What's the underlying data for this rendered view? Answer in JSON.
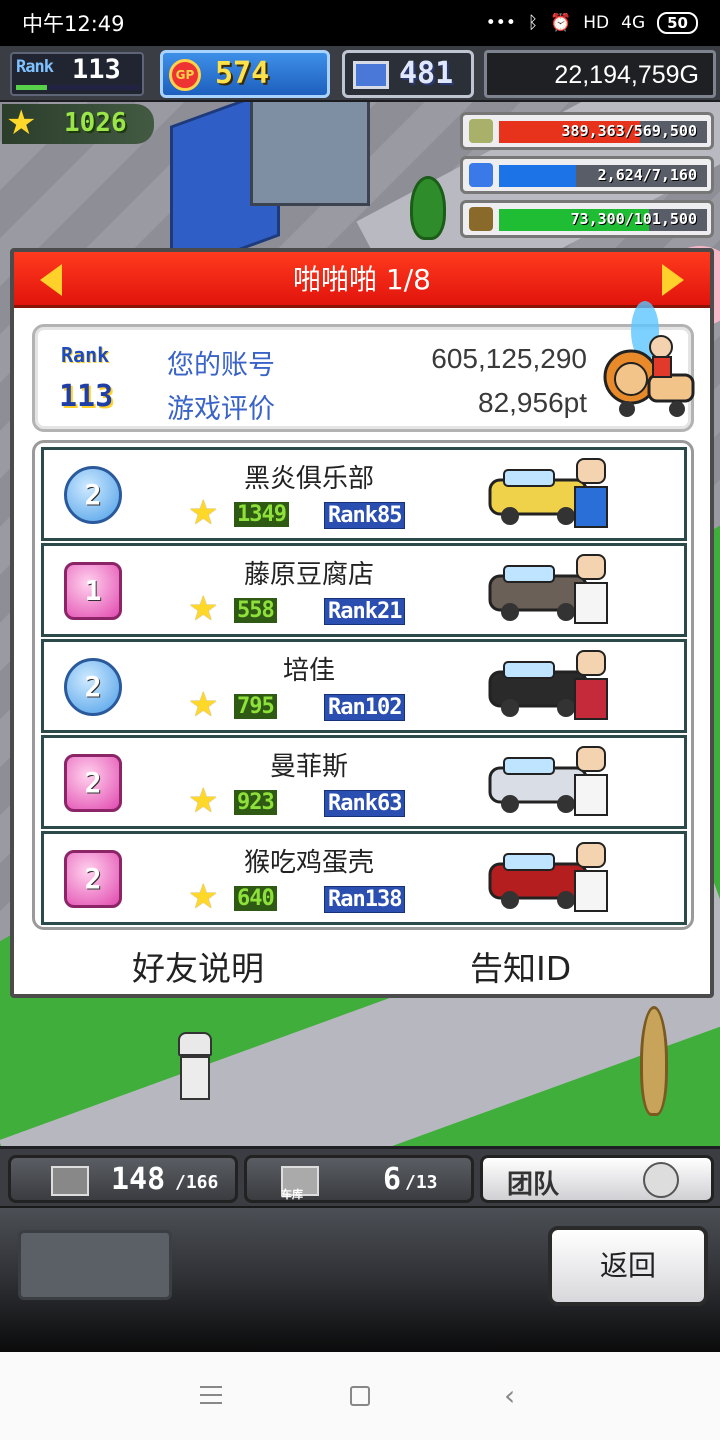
{
  "status_bar": {
    "time": "中午12:49",
    "signal_text": "4G",
    "hd_text": "HD",
    "battery": "50"
  },
  "hud": {
    "rank_label": "Rank",
    "rank_value": "113",
    "rank_progress": 0.25,
    "gp_icon": "GP",
    "gp_value": "574",
    "pc_value": "481",
    "money": "22,194,759G",
    "stars": "1026"
  },
  "resources": [
    {
      "icon": "coins-icon",
      "text": "389,363/569,500",
      "fraction": 0.68,
      "color": "#e8331c"
    },
    {
      "icon": "bottle-icon",
      "text": "2,624/7,160",
      "fraction": 0.37,
      "color": "#1c73e8"
    },
    {
      "icon": "leaf-icon",
      "text": "73,300/101,500",
      "fraction": 0.72,
      "color": "#1ebd34"
    }
  ],
  "dialog": {
    "title": "啪啪啪 1/8",
    "account": {
      "rank_label": "Rank",
      "rank_value": "113",
      "label_account": "您的账号",
      "label_rating": "游戏评价",
      "value_account": "605,125,290",
      "value_rating": "82,956pt"
    },
    "friends": [
      {
        "badge": "2",
        "badge_style": "blue",
        "name": "黑炎俱乐部",
        "stars": "1349",
        "rank": "Rank85",
        "vehicle_color": "#f0d24a",
        "driver_color": "#2a6fd8"
      },
      {
        "badge": "1",
        "badge_style": "pink",
        "name": "藤原豆腐店",
        "stars": "558",
        "rank": "Rank21",
        "vehicle_color": "#6a6057",
        "driver_color": "#f5f5f5"
      },
      {
        "badge": "2",
        "badge_style": "blue",
        "name": "培佳",
        "stars": "795",
        "rank": "Ran102",
        "vehicle_color": "#2a2a2a",
        "driver_color": "#c42a3a"
      },
      {
        "badge": "2",
        "badge_style": "pink",
        "name": "曼菲斯",
        "stars": "923",
        "rank": "Rank63",
        "vehicle_color": "#d9dde6",
        "driver_color": "#f5f5f5"
      },
      {
        "badge": "2",
        "badge_style": "pink",
        "name": "猴吃鸡蛋壳",
        "stars": "640",
        "rank": "Ran138",
        "vehicle_color": "#b51e1e",
        "driver_color": "#f5f5f5"
      }
    ],
    "link_left": "好友说明",
    "link_right": "告知ID"
  },
  "bottom": {
    "tab1_value": "148",
    "tab1_max": "/166",
    "tab2_label": "车库",
    "tab2_value": "6",
    "tab2_max": "/13",
    "tab3_label": "团队",
    "back_label": "返回"
  }
}
